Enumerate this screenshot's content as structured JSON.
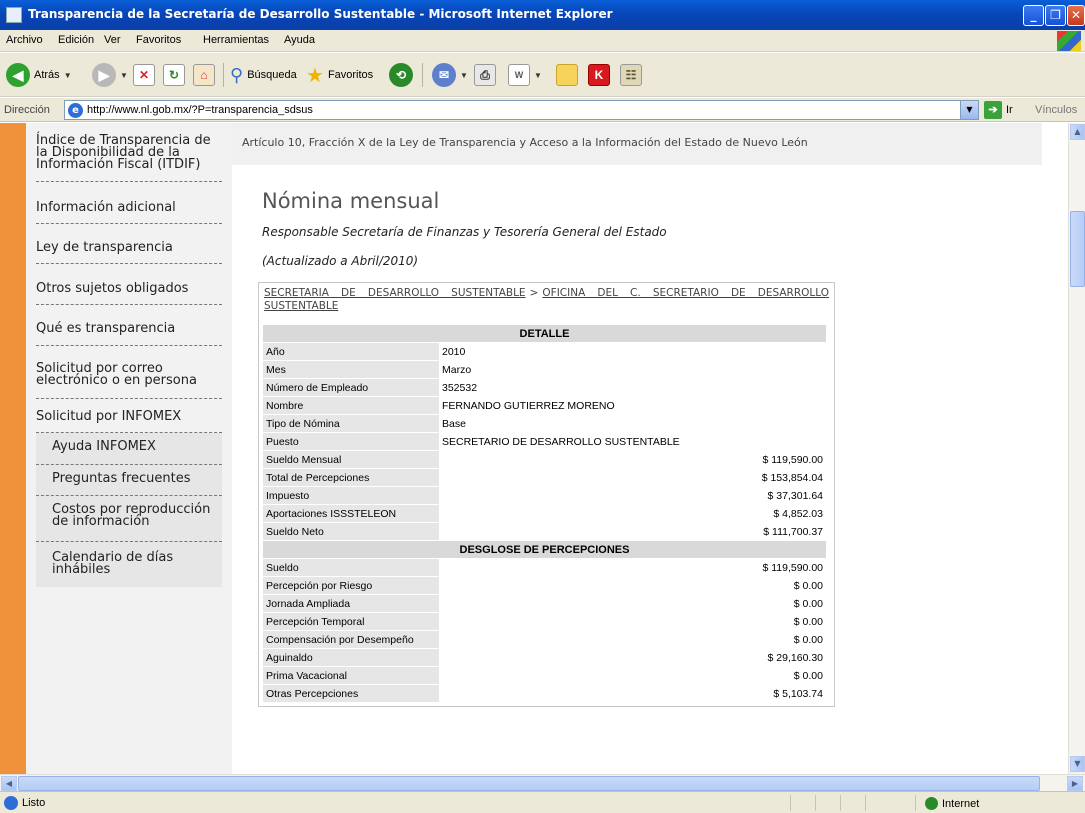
{
  "window": {
    "title": "Transparencia de la Secretaría de Desarrollo Sustentable - Microsoft Internet Explorer",
    "min": "_",
    "max": "❐",
    "close": "✕"
  },
  "menu": [
    "Archivo",
    "Edición",
    "Ver",
    "Favoritos",
    "Herramientas",
    "Ayuda"
  ],
  "toolbar": {
    "back_label": "Atrás",
    "search_label": "Búsqueda",
    "favorites_label": "Favoritos"
  },
  "address": {
    "label": "Dirección",
    "url": "http://www.nl.gob.mx/?P=transparencia_sdsus",
    "go_label": "Ir",
    "links_label": "Vínculos"
  },
  "sidebar": {
    "items": [
      "Índice de Transparencia de la Disponibilidad de la Información Fiscal (ITDIF)",
      "Información adicional",
      "Ley de transparencia",
      "Otros sujetos obligados",
      "Qué es transparencia",
      "Solicitud por correo electrónico o en persona",
      "Solicitud por INFOMEX"
    ],
    "subitems": [
      "Ayuda INFOMEX",
      "Preguntas frecuentes",
      "Costos por reproducción de información",
      "Calendario de días inhábiles"
    ]
  },
  "content": {
    "article": "Artículo 10, Fracción X de la Ley de Transparencia y Acceso a la Información del Estado de Nuevo León",
    "title": "Nómina mensual",
    "responsible": "Responsable Secretaría de Finanzas y Tesorería General del Estado",
    "updated": "(Actualizado a Abril/2010)",
    "breadcrumb": {
      "part1": "SECRETARIA DE DESARROLLO SUSTENTABLE",
      "sep": ">",
      "part2": "OFICINA DEL C. SECRETARIO DE DESARROLLO SUSTENTABLE"
    },
    "detalle_header": "DETALLE",
    "detalle": [
      {
        "k": "Año",
        "v": "2010",
        "right": false
      },
      {
        "k": "Mes",
        "v": "Marzo",
        "right": false
      },
      {
        "k": "Número de Empleado",
        "v": "352532",
        "right": false
      },
      {
        "k": "Nombre",
        "v": "FERNANDO GUTIERREZ MORENO",
        "right": false
      },
      {
        "k": "Tipo de Nómina",
        "v": "Base",
        "right": false
      },
      {
        "k": "Puesto",
        "v": "SECRETARIO DE DESARROLLO SUSTENTABLE",
        "right": false
      },
      {
        "k": "Sueldo Mensual",
        "v": "$ 119,590.00",
        "right": true
      },
      {
        "k": "Total de Percepciones",
        "v": "$ 153,854.04",
        "right": true
      },
      {
        "k": "Impuesto",
        "v": "$ 37,301.64",
        "right": true
      },
      {
        "k": "Aportaciones ISSSTELEON",
        "v": "$ 4,852.03",
        "right": true
      },
      {
        "k": "Sueldo Neto",
        "v": "$ 111,700.37",
        "right": true
      }
    ],
    "desglose_header": "DESGLOSE DE PERCEPCIONES",
    "desglose": [
      {
        "k": "Sueldo",
        "v": "$ 119,590.00"
      },
      {
        "k": "Percepción por Riesgo",
        "v": "$ 0.00"
      },
      {
        "k": "Jornada Ampliada",
        "v": "$ 0.00"
      },
      {
        "k": "Percepción Temporal",
        "v": "$ 0.00"
      },
      {
        "k": "Compensación por Desempeño",
        "v": "$ 0.00"
      },
      {
        "k": "Aguinaldo",
        "v": "$ 29,160.30"
      },
      {
        "k": "Prima Vacacional",
        "v": "$ 0.00"
      },
      {
        "k": "Otras Percepciones",
        "v": "$ 5,103.74"
      }
    ]
  },
  "status": {
    "text": "Listo",
    "zone": "Internet"
  },
  "colors": {
    "sidebar_accent": "#f0923c",
    "titlebar": "#0a4fc8"
  }
}
